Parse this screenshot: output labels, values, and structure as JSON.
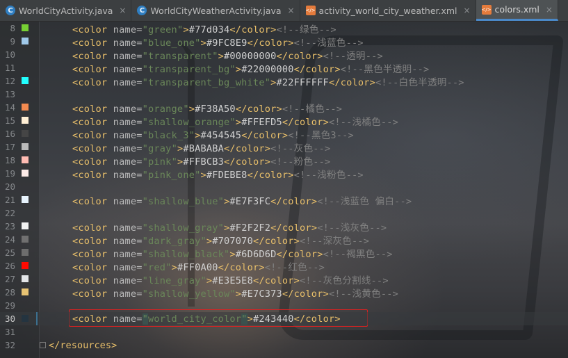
{
  "tabs": [
    {
      "label": "WorldCityActivity.java",
      "icon": "java-class-icon",
      "active": false
    },
    {
      "label": "WorldCityWeatherActivity.java",
      "icon": "java-class-icon",
      "active": false
    },
    {
      "label": "activity_world_city_weather.xml",
      "icon": "xml-file-icon",
      "active": false
    },
    {
      "label": "colors.xml",
      "icon": "xml-file-icon",
      "active": true
    }
  ],
  "lines": [
    {
      "num": "8",
      "swatch": "#77d034",
      "name": "green",
      "value": "#77d034",
      "comment": "<!--绿色-->"
    },
    {
      "num": "9",
      "swatch": "#9FC8E9",
      "name": "blue_one",
      "value": "#9FC8E9",
      "comment": "<!--浅蓝色-->"
    },
    {
      "num": "10",
      "swatch": "",
      "name": "transparent",
      "value": "#00000000",
      "comment": "<!--透明-->"
    },
    {
      "num": "11",
      "swatch": "#22000000",
      "name": "transparent_bg",
      "value": "#22000000",
      "comment": "<!--黑色半透明-->"
    },
    {
      "num": "12",
      "swatch": "#22FFFFFF",
      "name": "transparent_bg_white",
      "value": "#22FFFFFF",
      "comment": "<!--白色半透明-->"
    },
    {
      "num": "13"
    },
    {
      "num": "14",
      "swatch": "#F38A50",
      "name": "orange",
      "value": "#F38A50",
      "comment": "<!--橘色-->"
    },
    {
      "num": "15",
      "swatch": "#FFEFD5",
      "name": "shallow_orange",
      "value": "#FFEFD5",
      "comment": "<!--浅橘色-->"
    },
    {
      "num": "16",
      "swatch": "#454545",
      "name": "black_3",
      "value": "#454545",
      "comment": "<!--黑色3-->"
    },
    {
      "num": "17",
      "swatch": "#BABABA",
      "name": "gray",
      "value": "#BABABA",
      "comment": "<!--灰色-->"
    },
    {
      "num": "18",
      "swatch": "#FFBCB3",
      "name": "pink",
      "value": "#FFBCB3",
      "comment": "<!--粉色-->"
    },
    {
      "num": "19",
      "swatch": "#FDEBE8",
      "name": "pink_one",
      "value": "#FDEBE8",
      "comment": "<!--浅粉色-->"
    },
    {
      "num": "20"
    },
    {
      "num": "21",
      "swatch": "#E7F3FC",
      "name": "shallow_blue",
      "value": "#E7F3FC",
      "comment": "<!--浅蓝色 偏白-->"
    },
    {
      "num": "22"
    },
    {
      "num": "23",
      "swatch": "#F2F2F2",
      "name": "shallow_gray",
      "value": "#F2F2F2",
      "comment": "<!--浅灰色-->"
    },
    {
      "num": "24",
      "swatch": "#707070",
      "name": "dark_gray",
      "value": "#707070",
      "comment": "<!--深灰色-->"
    },
    {
      "num": "25",
      "swatch": "#6D6D6D",
      "name": "shallow_black",
      "value": "#6D6D6D",
      "comment": "<!--褐黑色-->"
    },
    {
      "num": "26",
      "swatch": "#FF0A00",
      "name": "red",
      "value": "#FF0A00",
      "comment": "<!--红色-->"
    },
    {
      "num": "27",
      "swatch": "#E3E5E8",
      "name": "line_gray",
      "value": "#E3E5E8",
      "comment": "<!--灰色分割线-->"
    },
    {
      "num": "28",
      "swatch": "#E7C373",
      "name": "shallow_yellow",
      "value": "#E7C373",
      "comment": "<!--浅黄色-->"
    },
    {
      "num": "29"
    },
    {
      "num": "30",
      "swatch": "#243440",
      "name": "world_city_color",
      "value": "#243440",
      "comment": "",
      "current": true
    },
    {
      "num": "31"
    },
    {
      "num": "32",
      "closing": "</resources>"
    }
  ],
  "syntax": {
    "open": "<color",
    "attr": "name=",
    "close": "</color>"
  }
}
